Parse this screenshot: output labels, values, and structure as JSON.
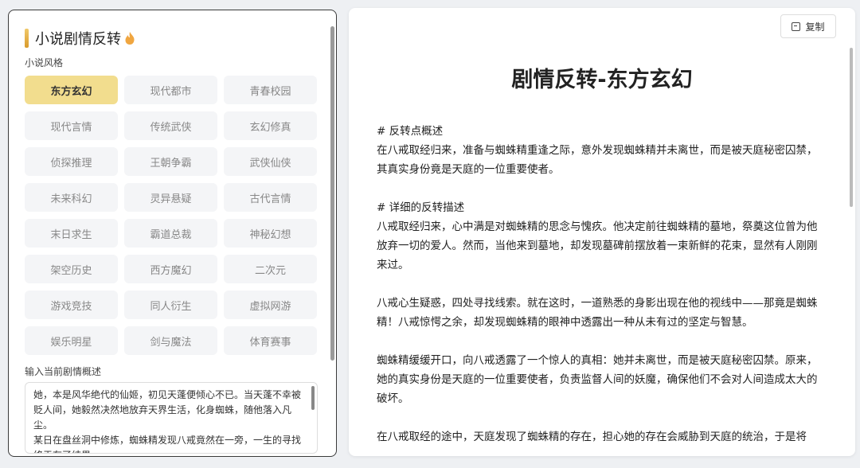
{
  "left": {
    "title": "小说剧情反转",
    "style_label": "小说风格",
    "styles": [
      {
        "label": "东方玄幻",
        "active": true
      },
      {
        "label": "现代都市",
        "active": false
      },
      {
        "label": "青春校园",
        "active": false
      },
      {
        "label": "现代言情",
        "active": false
      },
      {
        "label": "传统武侠",
        "active": false
      },
      {
        "label": "玄幻修真",
        "active": false
      },
      {
        "label": "侦探推理",
        "active": false
      },
      {
        "label": "王朝争霸",
        "active": false
      },
      {
        "label": "武侠仙侠",
        "active": false
      },
      {
        "label": "未来科幻",
        "active": false
      },
      {
        "label": "灵异悬疑",
        "active": false
      },
      {
        "label": "古代言情",
        "active": false
      },
      {
        "label": "末日求生",
        "active": false
      },
      {
        "label": "霸道总裁",
        "active": false
      },
      {
        "label": "神秘幻想",
        "active": false
      },
      {
        "label": "架空历史",
        "active": false
      },
      {
        "label": "西方魔幻",
        "active": false
      },
      {
        "label": "二次元",
        "active": false
      },
      {
        "label": "游戏竞技",
        "active": false
      },
      {
        "label": "同人衍生",
        "active": false
      },
      {
        "label": "虚拟网游",
        "active": false
      },
      {
        "label": "娱乐明星",
        "active": false
      },
      {
        "label": "剑与魔法",
        "active": false
      },
      {
        "label": "体育赛事",
        "active": false
      }
    ],
    "desc_label": "输入当前剧情概述",
    "desc_text": "她，本是风华绝代的仙姬，初见天蓬便倾心不已。当天蓬不幸被贬人间，她毅然决然地放弃天界生活，化身蜘蛛，随他落入凡尘。\n某日在盘丝洞中修炼，蜘蛛精发现八戒竟然在一旁，一生的寻找终于有了结果..."
  },
  "right": {
    "copy_label": "复制",
    "doc_title": "剧情反转-东方玄幻",
    "paragraphs": [
      "# 反转点概述",
      "在八戒取经归来，准备与蜘蛛精重逢之际，意外发现蜘蛛精并未离世，而是被天庭秘密囚禁，其真实身份竟是天庭的一位重要使者。",
      "",
      "# 详细的反转描述",
      "八戒取经归来，心中满是对蜘蛛精的思念与愧疚。他决定前往蜘蛛精的墓地，祭奠这位曾为他放弃一切的爱人。然而，当他来到墓地，却发现墓碑前摆放着一束新鲜的花束，显然有人刚刚来过。",
      "",
      "八戒心生疑惑，四处寻找线索。就在这时，一道熟悉的身影出现在他的视线中——那竟是蜘蛛精！八戒惊愕之余，却发现蜘蛛精的眼神中透露出一种从未有过的坚定与智慧。",
      "",
      "蜘蛛精缓缓开口，向八戒透露了一个惊人的真相：她并未离世，而是被天庭秘密囚禁。原来，她的真实身份是天庭的一位重要使者，负责监督人间的妖魔，确保他们不会对人间造成太大的破坏。",
      "",
      "在八戒取经的途中，天庭发现了蜘蛛精的存在，担心她的存在会威胁到天庭的统治，于是将"
    ]
  }
}
